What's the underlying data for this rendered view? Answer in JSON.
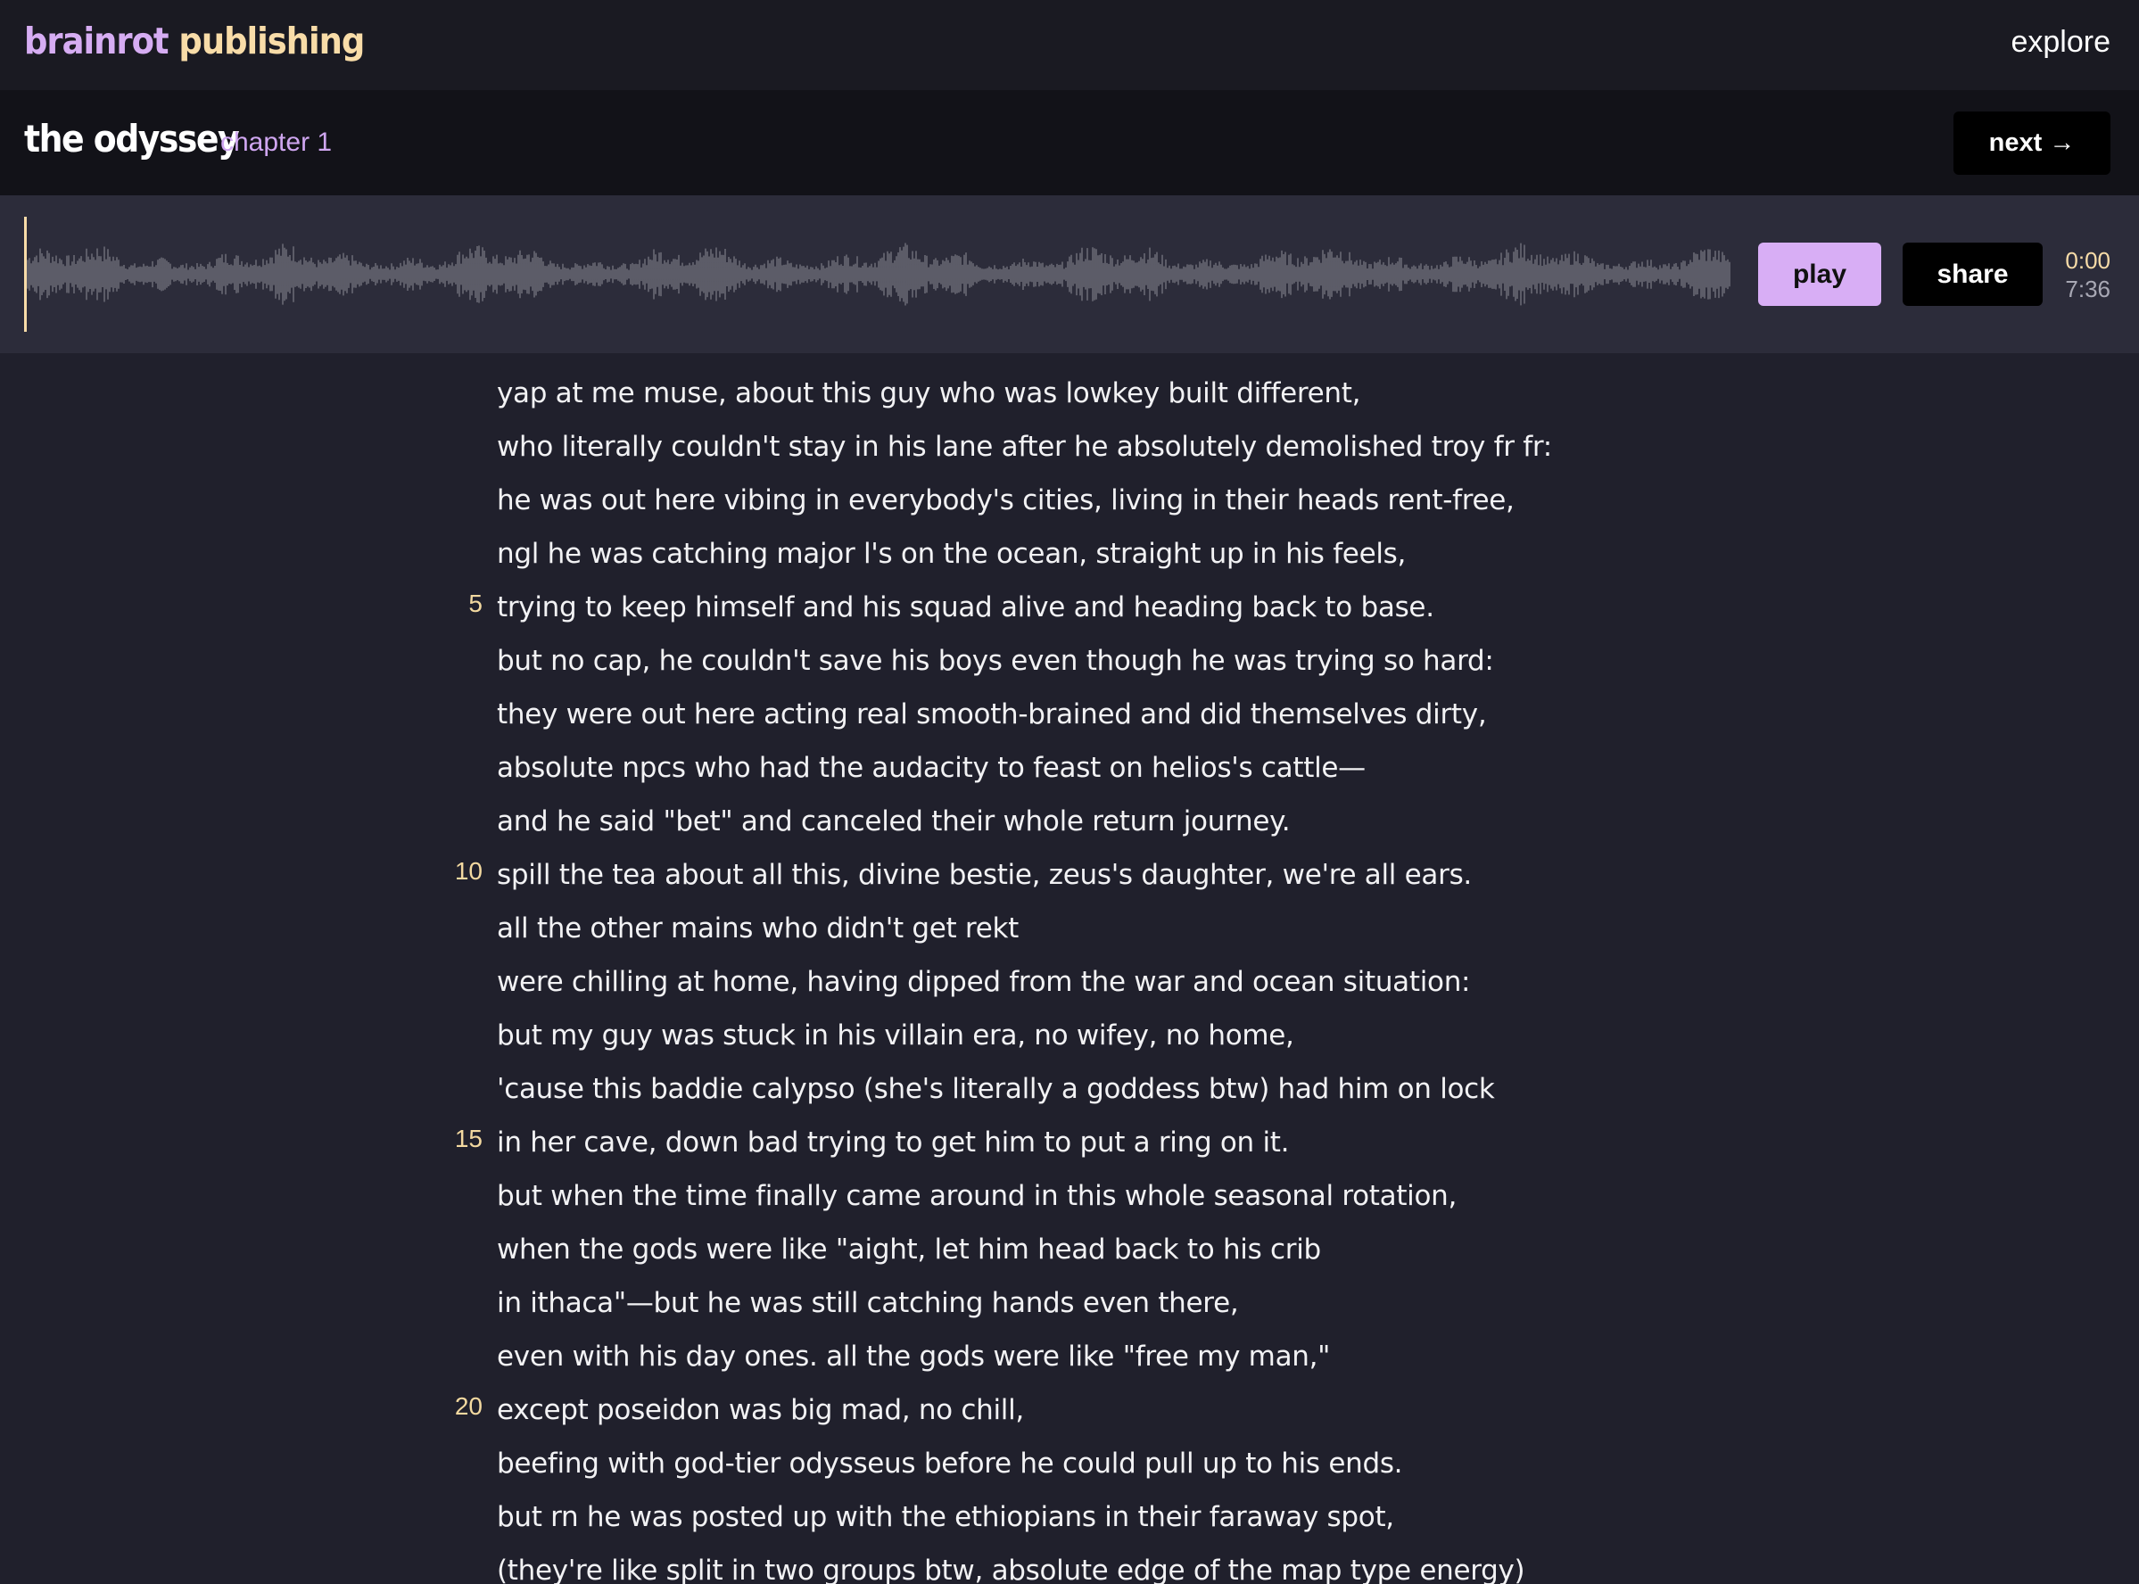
{
  "header": {
    "brand_part1": "brainrot",
    "brand_part2": "publishing",
    "nav_explore": "explore"
  },
  "book": {
    "title": "the odyssey",
    "chapter": "chapter 1",
    "next_label": "next",
    "next_arrow": "→"
  },
  "player": {
    "play_label": "play",
    "share_label": "share",
    "current_time": "0:00",
    "total_time": "7:36",
    "progress": 0.0
  },
  "colors": {
    "accent_purple": "#d8aef5",
    "accent_cream": "#f8dca8",
    "background": "#20202c"
  },
  "lines": [
    {
      "number": "",
      "text": "yap at me muse, about this guy who was lowkey built different,"
    },
    {
      "number": "",
      "text": "who literally couldn't stay in his lane after he absolutely demolished troy fr fr:"
    },
    {
      "number": "",
      "text": "he was out here vibing in everybody's cities, living in their heads rent-free,"
    },
    {
      "number": "",
      "text": "ngl he was catching major l's on the ocean, straight up in his feels,"
    },
    {
      "number": "5",
      "text": "trying to keep himself and his squad alive and heading back to base."
    },
    {
      "number": "",
      "text": "but no cap, he couldn't save his boys even though he was trying so hard:"
    },
    {
      "number": "",
      "text": "they were out here acting real smooth-brained and did themselves dirty,"
    },
    {
      "number": "",
      "text": "absolute npcs who had the audacity to feast on helios's cattle—"
    },
    {
      "number": "",
      "text": "and he said \"bet\" and canceled their whole return journey."
    },
    {
      "number": "10",
      "text": "spill the tea about all this, divine bestie, zeus's daughter, we're all ears."
    },
    {
      "number": "",
      "text": "all the other mains who didn't get rekt"
    },
    {
      "number": "",
      "text": "were chilling at home, having dipped from the war and ocean situation:"
    },
    {
      "number": "",
      "text": "but my guy was stuck in his villain era, no wifey, no home,"
    },
    {
      "number": "",
      "text": "'cause this baddie calypso (she's literally a goddess btw) had him on lock"
    },
    {
      "number": "15",
      "text": "in her cave, down bad trying to get him to put a ring on it."
    },
    {
      "number": "",
      "text": "but when the time finally came around in this whole seasonal rotation,"
    },
    {
      "number": "",
      "text": "when the gods were like \"aight, let him head back to his crib"
    },
    {
      "number": "",
      "text": "in ithaca\"—but he was still catching hands even there,"
    },
    {
      "number": "",
      "text": "even with his day ones. all the gods were like \"free my man,\""
    },
    {
      "number": "20",
      "text": "except poseidon was big mad, no chill,"
    },
    {
      "number": "",
      "text": "beefing with god-tier odysseus before he could pull up to his ends."
    },
    {
      "number": "",
      "text": "but rn he was posted up with the ethiopians in their faraway spot,"
    },
    {
      "number": "",
      "text": "(they're like split in two groups btw, absolute edge of the map type energy)"
    }
  ]
}
